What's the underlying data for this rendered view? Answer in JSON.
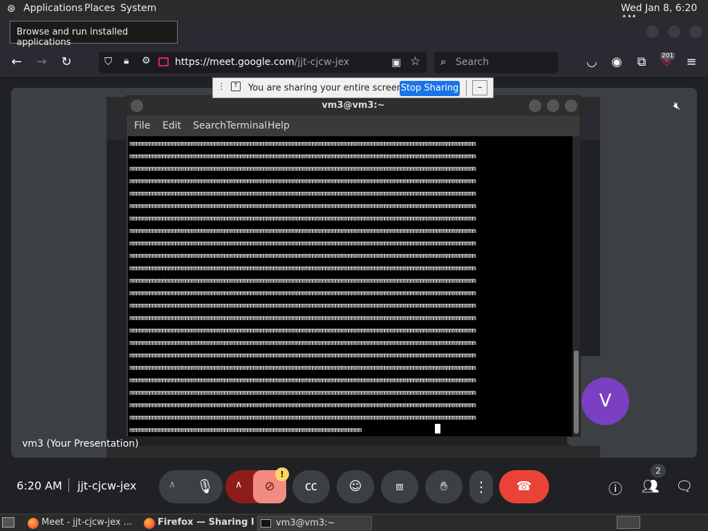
{
  "topbar": {
    "menus": [
      "Applications",
      "Places",
      "System"
    ],
    "datetime": "Wed Jan  8,  6:20 AM"
  },
  "tooltip": "Browse and run installed applications",
  "browser": {
    "url_host": "https://meet.google.com",
    "url_path": "/jjt-cjcw-jex",
    "search_placeholder": "Search",
    "badge_count": "201"
  },
  "share_notice": {
    "text": "You are sharing your entire screen.",
    "stop_button": "Stop Sharing"
  },
  "terminal": {
    "title": "vm3@vm3:~",
    "menu": [
      "File",
      "Edit",
      "Search",
      "Terminal",
      "Help"
    ],
    "line_text": "mmmmmmmmmmmmmmmmmmmmmmmmmmmmmmmmmmmmmmmmmmmmmmmmmmmmmmmmmmmmmmmmmmmmmmmmmmmmmmmmmmmmmmmmmmmmmmmmmmmmmmmmmm",
    "last_line_text": "mmmmmmmmmmmmmmmmmmmmmmmmmmmmmmmmmmmmmmmmmmmmmmmmmmmmmmmmmmmmmmmmmmmmmmm"
  },
  "presentation_label": "vm3 (Your Presentation)",
  "participant_initial": "V",
  "meeting": {
    "time": "6:20 AM",
    "code": "jjt-cjcw-jex",
    "people_count": "2"
  },
  "taskbar": {
    "items": [
      "Meet - jjt-cjcw-jex ...",
      "Firefox — Sharing I...",
      "vm3@vm3:~"
    ]
  },
  "colors": {
    "end_call": "#ea4335",
    "camera_off": "#f28b82",
    "accent": "#1a73e8",
    "avatar": "#7b3fc1"
  }
}
